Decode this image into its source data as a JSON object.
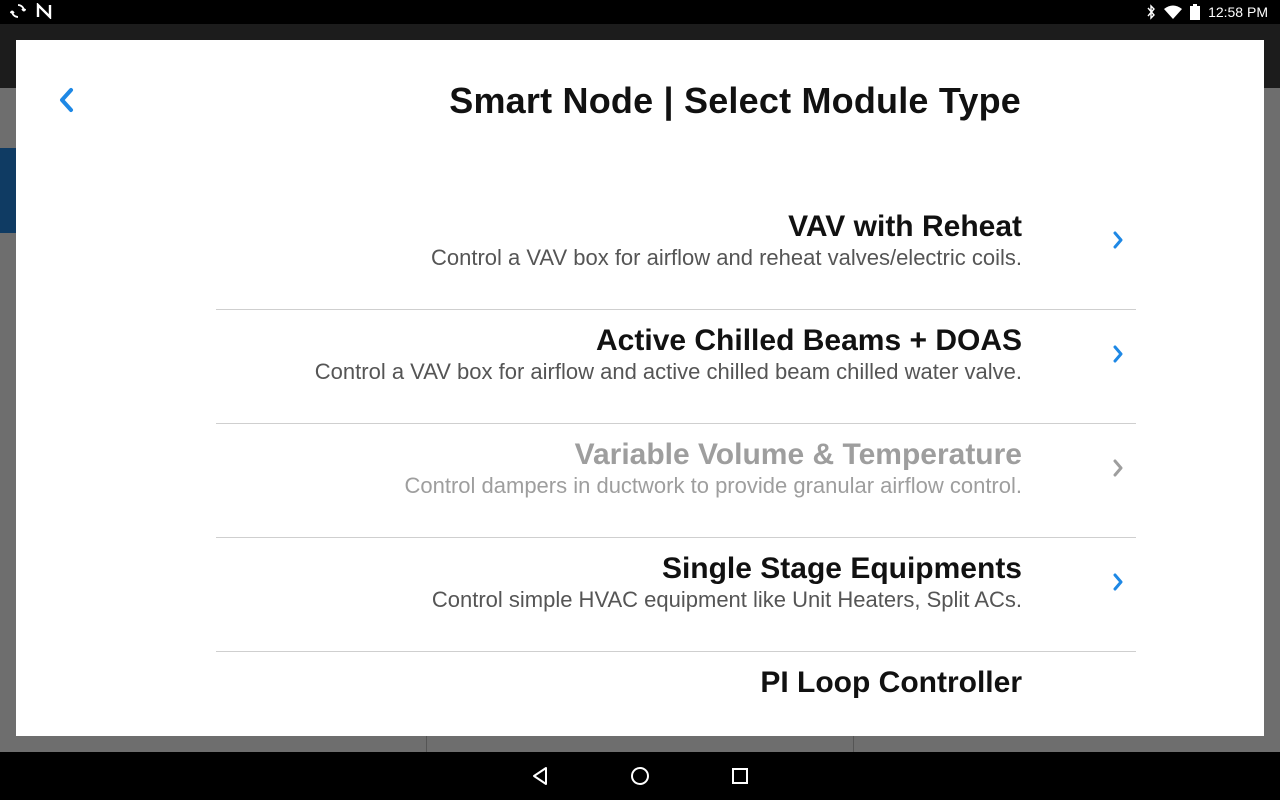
{
  "status_bar": {
    "time": "12:58 PM",
    "left_icons": [
      "sync-icon",
      "n-app-icon"
    ],
    "right_icons": [
      "bluetooth-icon",
      "wifi-icon",
      "battery-icon"
    ]
  },
  "dialog": {
    "title": "Smart Node | Select Module Type",
    "back_icon": "chevron-left-icon"
  },
  "modules": [
    {
      "title": "VAV with Reheat",
      "description": "Control a VAV box for airflow and reheat valves/electric coils.",
      "enabled": true
    },
    {
      "title": "Active Chilled Beams + DOAS",
      "description": "Control a VAV box for airflow and active chilled beam chilled water valve.",
      "enabled": true
    },
    {
      "title": "Variable Volume & Temperature",
      "description": "Control dampers in ductwork to provide granular airflow control.",
      "enabled": false
    },
    {
      "title": "Single Stage Equipments",
      "description": "Control simple HVAC equipment like Unit Heaters, Split ACs.",
      "enabled": true
    },
    {
      "title": "PI Loop Controller",
      "description": "",
      "enabled": true
    }
  ],
  "nav_bar": {
    "icons": [
      "nav-back-icon",
      "nav-home-icon",
      "nav-recents-icon"
    ]
  },
  "colors": {
    "accent": "#1e88e5",
    "disabled": "#9e9e9e",
    "title": "#111111",
    "description": "#555555"
  }
}
